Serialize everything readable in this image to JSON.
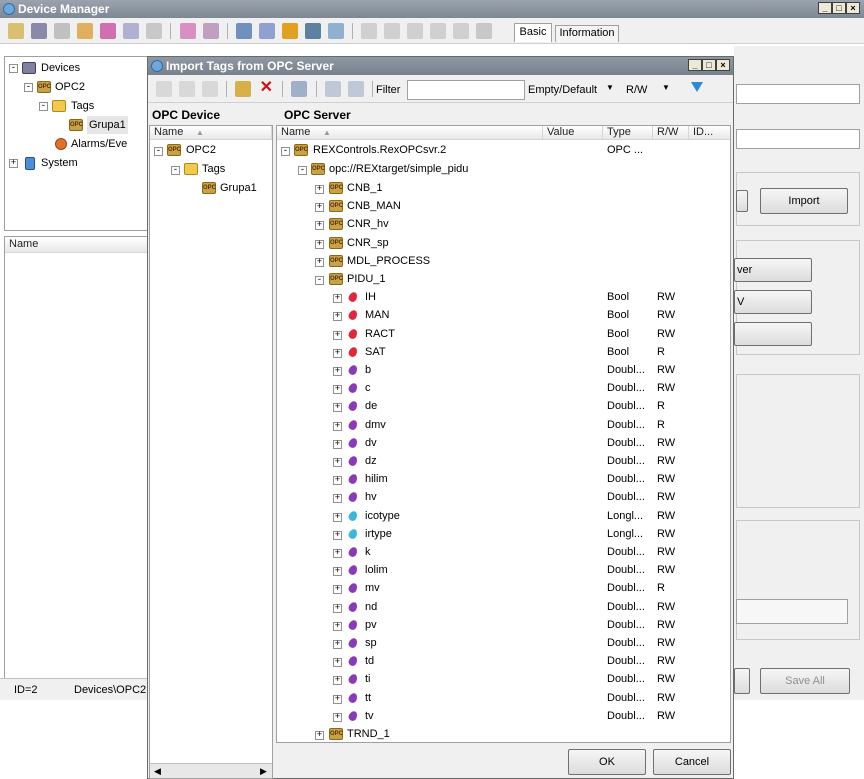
{
  "main_window": {
    "title": "Device Manager",
    "tabs": [
      "Basic",
      "Information"
    ],
    "tree": {
      "devices": "Devices",
      "opc2": "OPC2",
      "tags": "Tags",
      "grupa1": "Grupa1",
      "alarms": "Alarms/Eve",
      "system": "System"
    },
    "list_header_name": "Name",
    "status_id": "ID=2",
    "status_path": "Devices\\OPC2",
    "buttons": {
      "import": "Import",
      "btn_a": "ver",
      "btn_b": "V",
      "save_all": "Save All"
    }
  },
  "dialog": {
    "title": "Import Tags from OPC Server",
    "filter_label": "Filter",
    "filter_value": "",
    "filter_mode": "Empty/Default",
    "access_mode": "R/W",
    "left_header": "OPC Device",
    "right_header": "OPC Server",
    "left_col_name": "Name",
    "left_tree": {
      "opc2": "OPC2",
      "tags": "Tags",
      "grupa1": "Grupa1"
    },
    "columns": {
      "name": "Name",
      "value": "Value",
      "type": "Type",
      "rw": "R/W",
      "id": "ID..."
    },
    "server_node": {
      "name": "REXControls.RexOPCsvr.2",
      "type": "OPC ..."
    },
    "url_node": "opc://REXtarget/simple_pidu",
    "groups": [
      "CNB_1",
      "CNB_MAN",
      "CNR_hv",
      "CNR_sp",
      "MDL_PROCESS",
      "PIDU_1"
    ],
    "last_group": "TRND_1",
    "items": [
      {
        "name": "IH",
        "type": "Bool",
        "rw": "RW",
        "kind": "bool"
      },
      {
        "name": "MAN",
        "type": "Bool",
        "rw": "RW",
        "kind": "bool"
      },
      {
        "name": "RACT",
        "type": "Bool",
        "rw": "RW",
        "kind": "bool"
      },
      {
        "name": "SAT",
        "type": "Bool",
        "rw": "R",
        "kind": "bool"
      },
      {
        "name": "b",
        "type": "Doubl...",
        "rw": "RW",
        "kind": "double"
      },
      {
        "name": "c",
        "type": "Doubl...",
        "rw": "RW",
        "kind": "double"
      },
      {
        "name": "de",
        "type": "Doubl...",
        "rw": "R",
        "kind": "double"
      },
      {
        "name": "dmv",
        "type": "Doubl...",
        "rw": "R",
        "kind": "double"
      },
      {
        "name": "dv",
        "type": "Doubl...",
        "rw": "RW",
        "kind": "double"
      },
      {
        "name": "dz",
        "type": "Doubl...",
        "rw": "RW",
        "kind": "double"
      },
      {
        "name": "hilim",
        "type": "Doubl...",
        "rw": "RW",
        "kind": "double"
      },
      {
        "name": "hv",
        "type": "Doubl...",
        "rw": "RW",
        "kind": "double"
      },
      {
        "name": "icotype",
        "type": "Longl...",
        "rw": "RW",
        "kind": "long"
      },
      {
        "name": "irtype",
        "type": "Longl...",
        "rw": "RW",
        "kind": "long"
      },
      {
        "name": "k",
        "type": "Doubl...",
        "rw": "RW",
        "kind": "double"
      },
      {
        "name": "lolim",
        "type": "Doubl...",
        "rw": "RW",
        "kind": "double"
      },
      {
        "name": "mv",
        "type": "Doubl...",
        "rw": "R",
        "kind": "double"
      },
      {
        "name": "nd",
        "type": "Doubl...",
        "rw": "RW",
        "kind": "double"
      },
      {
        "name": "pv",
        "type": "Doubl...",
        "rw": "RW",
        "kind": "double"
      },
      {
        "name": "sp",
        "type": "Doubl...",
        "rw": "RW",
        "kind": "double"
      },
      {
        "name": "td",
        "type": "Doubl...",
        "rw": "RW",
        "kind": "double"
      },
      {
        "name": "ti",
        "type": "Doubl...",
        "rw": "RW",
        "kind": "double"
      },
      {
        "name": "tt",
        "type": "Doubl...",
        "rw": "RW",
        "kind": "double"
      },
      {
        "name": "tv",
        "type": "Doubl...",
        "rw": "RW",
        "kind": "double"
      }
    ],
    "ok": "OK",
    "cancel": "Cancel"
  },
  "colors": {
    "bool_tag": "#e0283a",
    "double_tag": "#8a3ab8",
    "long_tag": "#3ab8d8",
    "titlebar": "#8c95a0"
  }
}
